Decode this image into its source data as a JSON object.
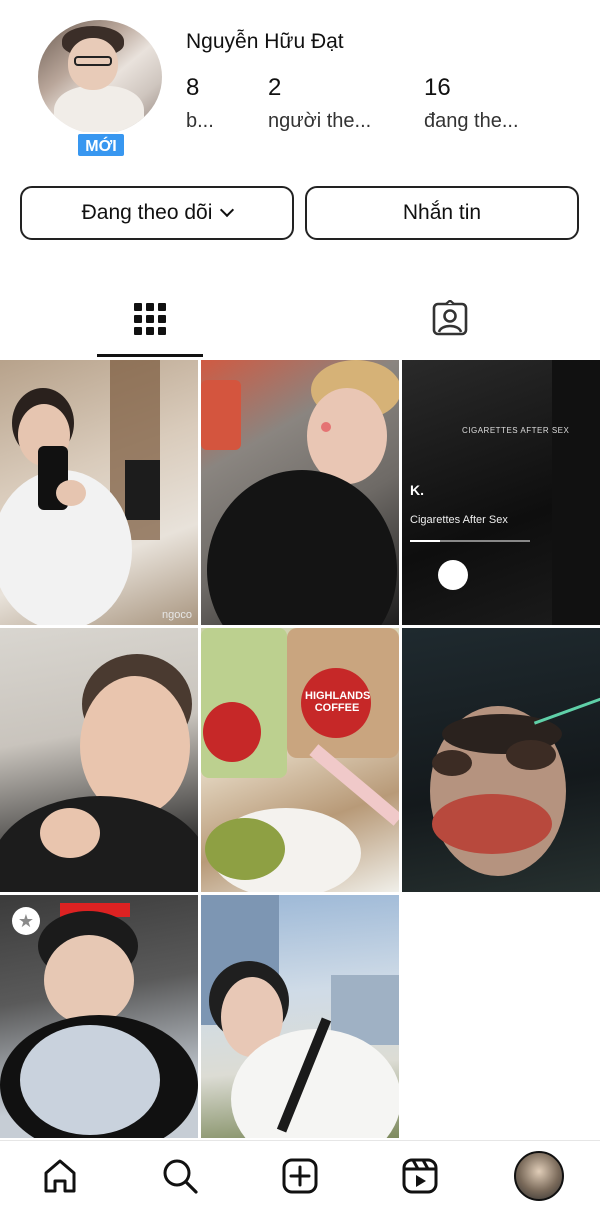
{
  "profile": {
    "username": "Nguyễn Hữu Đạt",
    "new_badge": "MỚI",
    "stats": {
      "posts": {
        "count": "8",
        "label": "b..."
      },
      "followers": {
        "count": "2",
        "label": "người the..."
      },
      "following": {
        "count": "16",
        "label": "đang the..."
      }
    }
  },
  "actions": {
    "following_label": "Đang theo dõi",
    "message_label": "Nhắn tin"
  },
  "tabs": {
    "grid_icon": "grid-icon",
    "tagged_icon": "tagged-user-icon",
    "active": "grid"
  },
  "posts": [
    {
      "id": 1,
      "watermark": "ngoco"
    },
    {
      "id": 2
    },
    {
      "id": 3,
      "title": "CIGARETTES AFTER SEX",
      "artist": "K.",
      "song": "Cigarettes After Sex"
    },
    {
      "id": 4
    },
    {
      "id": 5,
      "brand": "HIGHLANDS COFFEE"
    },
    {
      "id": 6
    },
    {
      "id": 7,
      "pinned_icon": "star-icon"
    },
    {
      "id": 8
    }
  ],
  "bottom_nav": {
    "items": [
      "home-icon",
      "search-icon",
      "create-icon",
      "reels-icon",
      "profile-avatar"
    ]
  },
  "colors": {
    "accent": "#3897f0",
    "text": "#111111",
    "border": "#222222"
  }
}
